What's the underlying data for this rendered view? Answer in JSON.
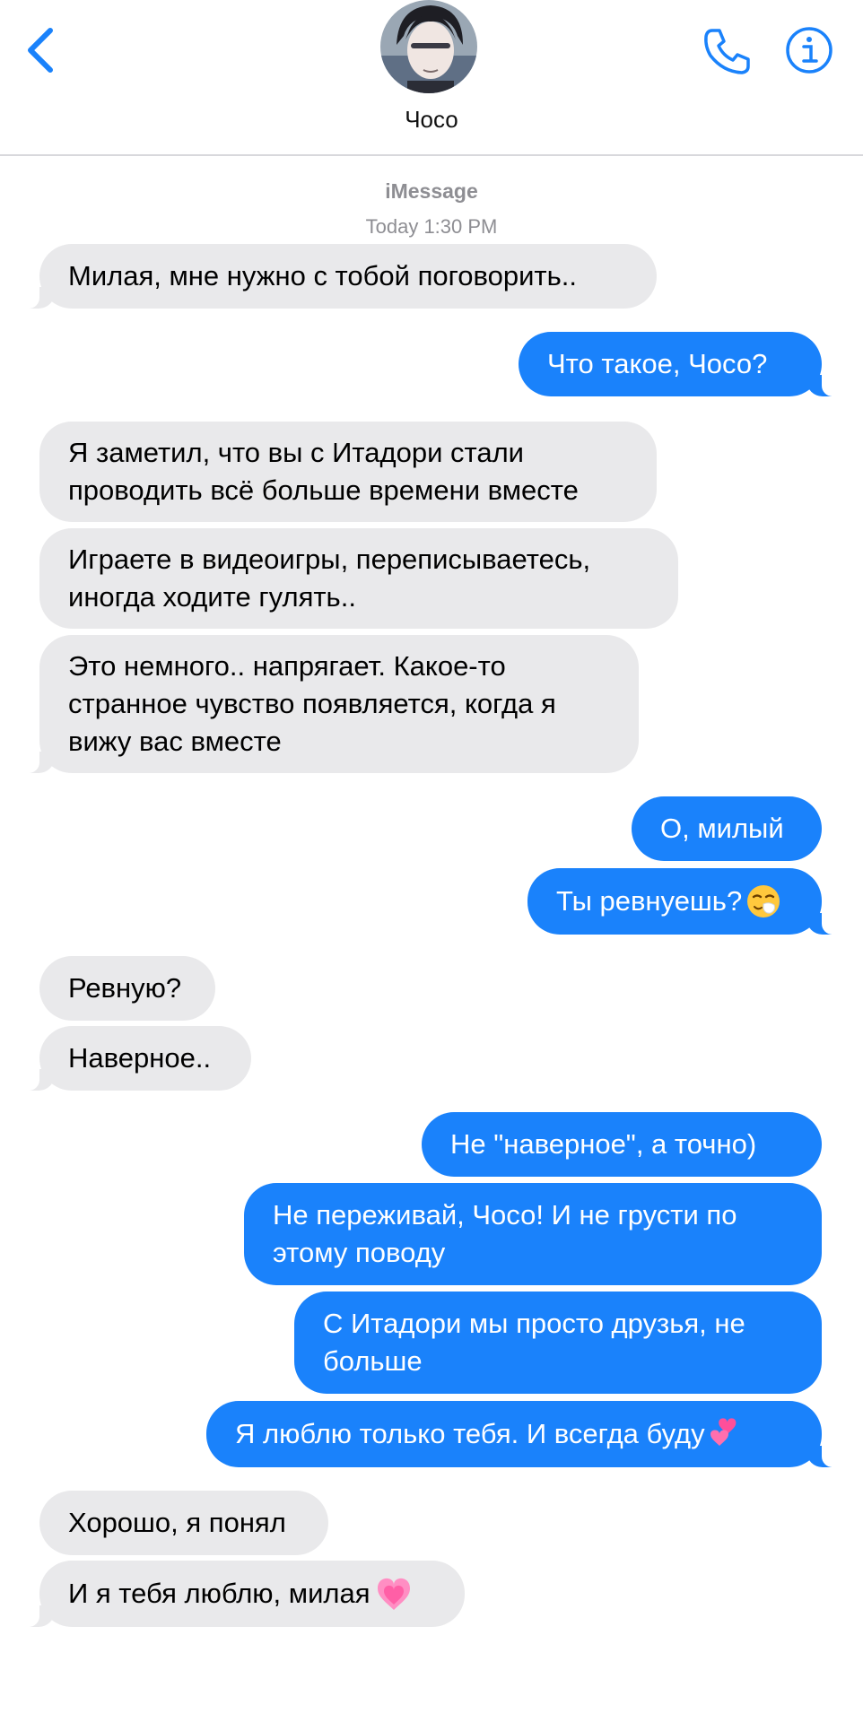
{
  "header": {
    "contact_name": "Чосо",
    "back_icon": "chevron-left-icon",
    "phone_icon": "phone-icon",
    "info_icon": "info-icon",
    "accent_color": "#1a82fb"
  },
  "conversation": {
    "service": "iMessage",
    "timestamp": "Today 1:30 PM"
  },
  "messages": [
    {
      "from": "them",
      "text": "Милая, мне нужно с тобой поговорить.."
    },
    {
      "from": "me",
      "text": "Что такое, Чосо?"
    },
    {
      "from": "them",
      "text": "Я заметил, что вы с Итадори стали\nпроводить всё больше времени вместе"
    },
    {
      "from": "them",
      "text": "Играете в видеоигры, переписываетесь,\nиногда ходите гулять.."
    },
    {
      "from": "them",
      "text": "Это немного.. напрягает. Какое-то\nстранное чувство появляется, когда я\nвижу вас вместе"
    },
    {
      "from": "me",
      "text": "О, милый"
    },
    {
      "from": "me",
      "text": "Ты ревнуешь?",
      "emoji": "sneezing-face-emoji"
    },
    {
      "from": "them",
      "text": "Ревную?"
    },
    {
      "from": "them",
      "text": "Наверное.."
    },
    {
      "from": "me",
      "text": "Не \"наверное\", а точно)"
    },
    {
      "from": "me",
      "text": "Не переживай, Чосо! И не грусти по\nэтому поводу"
    },
    {
      "from": "me",
      "text": "С Итадори мы просто друзья, не\nбольше"
    },
    {
      "from": "me",
      "text": "Я люблю только тебя. И всегда буду ",
      "emoji": "two-hearts-emoji"
    },
    {
      "from": "them",
      "text": "Хорошо, я понял"
    },
    {
      "from": "them",
      "text": "И я тебя люблю, милая ",
      "emoji": "growing-heart-emoji"
    }
  ]
}
